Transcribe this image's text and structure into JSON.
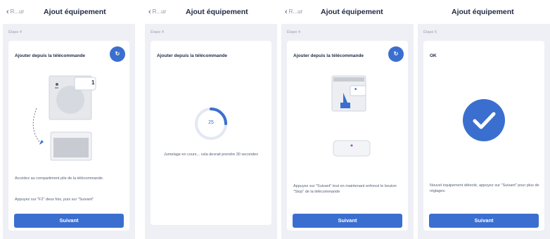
{
  "screens": [
    {
      "back_label": "R...ur",
      "title": "Ajout équipement",
      "step": "Étape 4",
      "card_title": "Ajouter depuis la télécommande",
      "device_number": "1",
      "instruction": "Accédez au compartiment pile de la télécommande.",
      "hint": "Appuyez sur \"F2\" deux fois, puis sur \"Suivant\"",
      "next_label": "Suivant"
    },
    {
      "back_label": "R...ur",
      "title": "Ajout équipement",
      "step": "Étape 4",
      "card_title": "Ajouter depuis la télécommande",
      "progress_value": "25",
      "progress_fraction": 0.25,
      "status_text": "Jumelage en cours... cela devrait prendre 30 secondes"
    },
    {
      "back_label": "R...ur",
      "title": "Ajout équipement",
      "step": "Étape 4",
      "card_title": "Ajouter depuis la télécommande",
      "instruction": "Appuyez sur \"Suivant\" tout en maintenant enfoncé le bouton \"Stop\" de la télécommande",
      "next_label": "Suivant"
    },
    {
      "title": "Ajout équipement",
      "step": "Étape 5",
      "result_label": "OK",
      "instruction": "Nouvel équipement détecté, appuyez sur \"Suivant\" pour plus de réglages.",
      "next_label": "Suivant"
    }
  ],
  "colors": {
    "accent": "#3a6fcf",
    "success": "#3a6fcf",
    "background": "#eef0f5"
  }
}
